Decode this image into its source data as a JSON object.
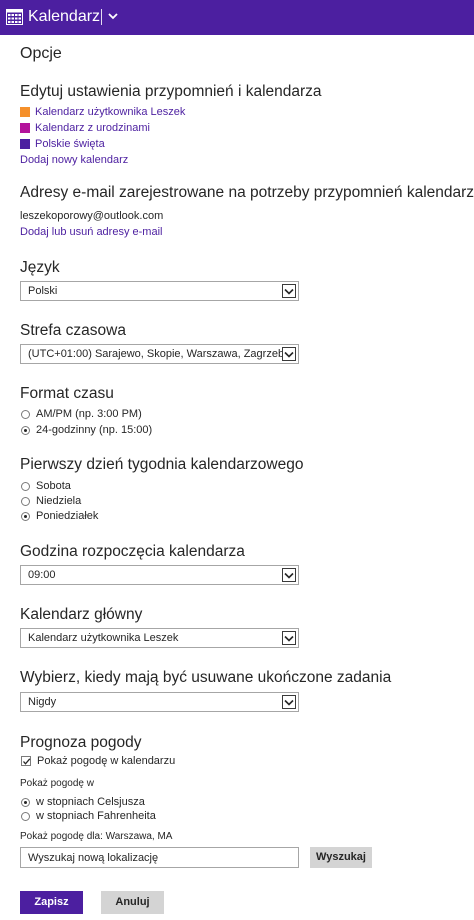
{
  "header": {
    "app_title": "Kalendarz",
    "bg_color": "#4c1fa0"
  },
  "page_title": "Opcje",
  "reminders": {
    "heading": "Edytuj ustawienia przypomnień i kalendarza",
    "calendars": [
      {
        "label": "Kalendarz użytkownika Leszek",
        "color": "#f5902b"
      },
      {
        "label": "Kalendarz z urodzinami",
        "color": "#b3139b"
      },
      {
        "label": "Polskie święta",
        "color": "#4c1fa0"
      }
    ],
    "add_calendar": "Dodaj nowy kalendarz"
  },
  "emails": {
    "heading": "Adresy e-mail zarejestrowane na potrzeby przypomnień kalendarza",
    "address": "leszekoporowy@outlook.com",
    "manage_link": "Dodaj lub usuń adresy e-mail"
  },
  "language": {
    "heading": "Język",
    "selected": "Polski"
  },
  "timezone": {
    "heading": "Strefa czasowa",
    "selected": "(UTC+01:00) Sarajewo, Skopie, Warszawa, Zagrzeb"
  },
  "time_format": {
    "heading": "Format czasu",
    "options": [
      {
        "label": "AM/PM (np. 3:00 PM)",
        "checked": false
      },
      {
        "label": "24-godzinny (np. 15:00)",
        "checked": true
      }
    ]
  },
  "first_day": {
    "heading": "Pierwszy dzień tygodnia kalendarzowego",
    "options": [
      {
        "label": "Sobota",
        "checked": false
      },
      {
        "label": "Niedziela",
        "checked": false
      },
      {
        "label": "Poniedziałek",
        "checked": true
      }
    ]
  },
  "start_hour": {
    "heading": "Godzina rozpoczęcia kalendarza",
    "selected": "09:00"
  },
  "main_calendar": {
    "heading": "Kalendarz główny",
    "selected": "Kalendarz użytkownika Leszek"
  },
  "completed_tasks": {
    "heading": "Wybierz, kiedy mają być usuwane ukończone zadania",
    "selected": "Nigdy"
  },
  "weather": {
    "heading": "Prognoza pogody",
    "show_label": "Pokaż pogodę w kalendarzu",
    "show_checked": true,
    "units_label": "Pokaż pogodę w",
    "units": [
      {
        "label": "w stopniach Celsjusza",
        "checked": true
      },
      {
        "label": "w stopniach Fahrenheita",
        "checked": false
      }
    ],
    "location_label": "Pokaż pogodę dla: Warszawa, MA",
    "search_placeholder": "Wyszukaj nową lokalizację",
    "search_button": "Wyszukaj"
  },
  "actions": {
    "save": "Zapisz",
    "cancel": "Anuluj"
  }
}
